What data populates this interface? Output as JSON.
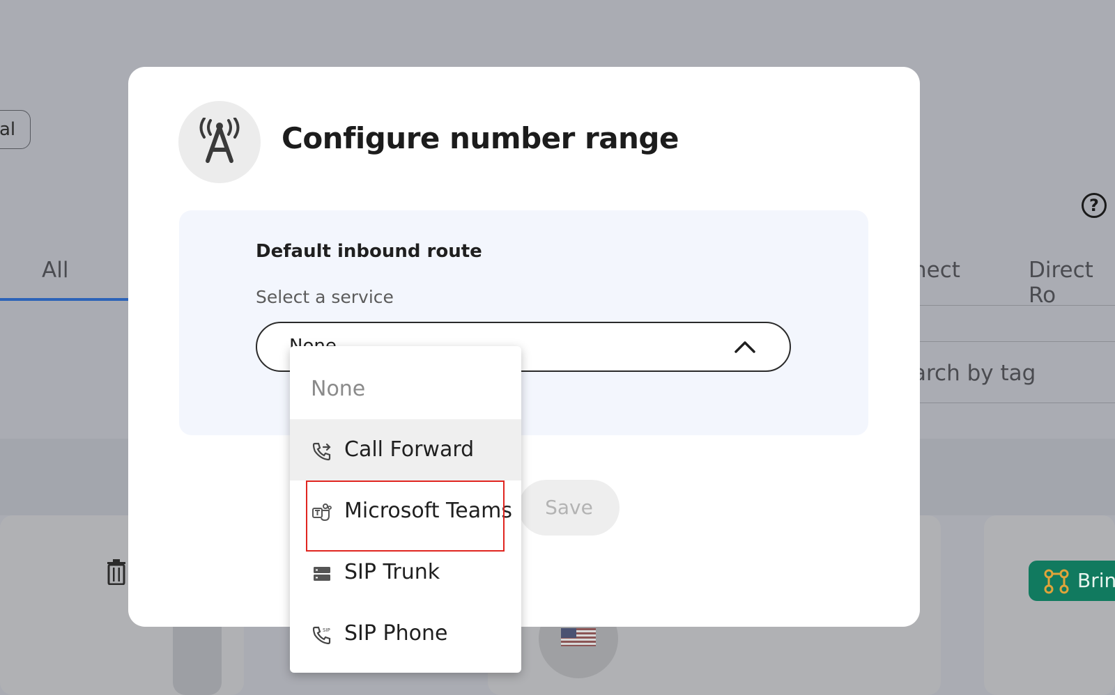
{
  "background": {
    "pill_text": "al",
    "help_icon": "?",
    "tabs": [
      "All",
      "nect",
      "Direct Ro"
    ],
    "search_placeholder": "arch by tag",
    "bring_button": "Brin"
  },
  "modal": {
    "title": "Configure number range",
    "icon": "antenna-icon",
    "section_title": "Default inbound route",
    "field_label": "Select a service",
    "select_value": "None",
    "save_label": "Save"
  },
  "menu": {
    "items": [
      {
        "label": "None",
        "icon": ""
      },
      {
        "label": "Call Forward",
        "icon": "call-forward-icon"
      },
      {
        "label": "Microsoft Teams",
        "icon": "teams-icon"
      },
      {
        "label": "SIP Trunk",
        "icon": "server-icon"
      },
      {
        "label": "SIP Phone",
        "icon": "sip-phone-icon"
      }
    ]
  },
  "colors": {
    "overlay": "#aaacb3",
    "tab_underline": "#2c63b8",
    "highlight": "#e0251f",
    "panel": "#f3f6fd",
    "bring_button": "#117a5f"
  }
}
